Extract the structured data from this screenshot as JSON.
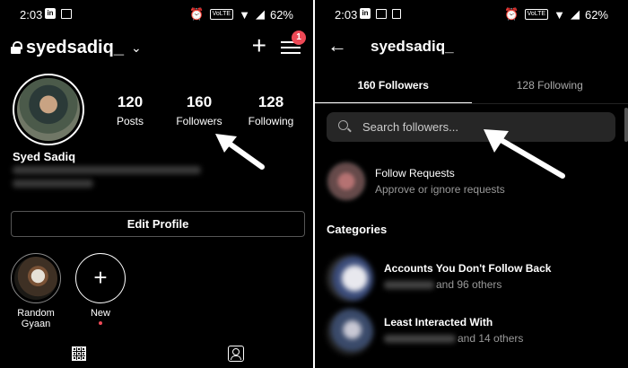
{
  "left_screen": {
    "status": {
      "time": "2:03",
      "battery": "62%",
      "volte": "VoLTE"
    },
    "header": {
      "username": "syedsadiq_",
      "notification_count": "1"
    },
    "stats": [
      {
        "value": "120",
        "label": "Posts"
      },
      {
        "value": "160",
        "label": "Followers"
      },
      {
        "value": "128",
        "label": "Following"
      }
    ],
    "profile_name": "Syed Sadiq",
    "edit_profile_label": "Edit Profile",
    "highlights": [
      {
        "label": "Random Gyaan"
      },
      {
        "label": "New"
      }
    ],
    "nav_icons": [
      "grid-icon",
      "tagged-icon"
    ]
  },
  "right_screen": {
    "status": {
      "time": "2:03",
      "battery": "62%",
      "volte": "VoLTE"
    },
    "header": {
      "title": "syedsadiq_"
    },
    "tabs": [
      {
        "label": "160 Followers",
        "active": true
      },
      {
        "label": "128 Following",
        "active": false
      }
    ],
    "search": {
      "placeholder": "Search followers..."
    },
    "follow_requests": {
      "title": "Follow Requests",
      "subtitle": "Approve or ignore requests"
    },
    "categories_heading": "Categories",
    "categories": [
      {
        "title": "Accounts You Don't Follow Back",
        "subtitle": "and 96 others"
      },
      {
        "title": "Least Interacted With",
        "subtitle": "and 14 others"
      }
    ]
  },
  "colors": {
    "background": "#000000",
    "badge": "#ed4956",
    "search_bg": "#262626",
    "secondary_text": "#999999"
  }
}
